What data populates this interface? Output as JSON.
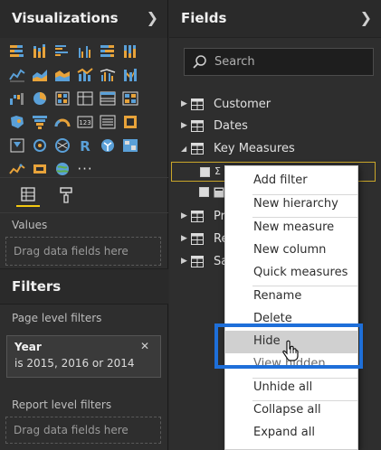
{
  "colors": {
    "accent_yellow": "#f2c811",
    "highlight_outline": "#1e6fd9",
    "menu_hover": "#d0d0d0",
    "pane_bg": "#2e2e2e"
  },
  "visualizations": {
    "title": "Visualizations",
    "chevron": "chevron-right-icon",
    "more_label": "···",
    "tabs": [
      "fields-tab",
      "format-tab"
    ],
    "values_label": "Values",
    "drop_hint": "Drag data fields here"
  },
  "filters": {
    "title": "Filters",
    "page_level_label": "Page level filters",
    "card": {
      "field": "Year",
      "value": "is 2015, 2016 or 2014",
      "close": "✕"
    },
    "report_level_label": "Report level filters",
    "drop_hint": "Drag data fields here"
  },
  "fields": {
    "title": "Fields",
    "chevron": "chevron-right-icon",
    "search_placeholder": "Search",
    "tables": [
      {
        "name": "Customer",
        "expanded": false
      },
      {
        "name": "Dates",
        "expanded": false
      },
      {
        "name": "Key Measures",
        "expanded": true
      },
      {
        "name": "Pr",
        "expanded": false
      },
      {
        "name": "Re",
        "expanded": false
      },
      {
        "name": "Sa",
        "expanded": false
      }
    ],
    "measure_icon": "Σ"
  },
  "context_menu": {
    "items": [
      "Add filter",
      "New hierarchy",
      "New measure",
      "New column",
      "Quick measures",
      "Rename",
      "Delete",
      "Hide",
      "View hidden",
      "Unhide all",
      "Collapse all",
      "Expand all"
    ],
    "highlighted": "Hide"
  }
}
